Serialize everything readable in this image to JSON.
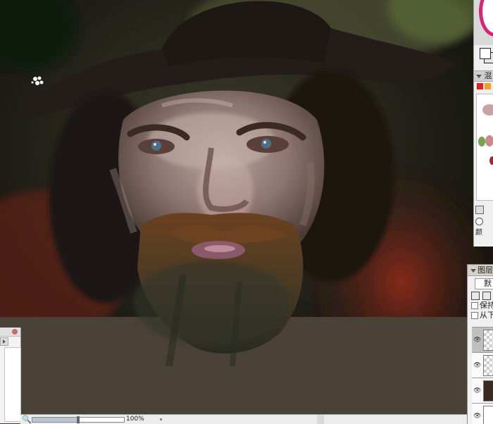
{
  "mixer": {
    "title": "混",
    "colors": [
      "#e02020",
      "#f2a020"
    ]
  },
  "color_panel": {
    "label": "颜"
  },
  "layers": {
    "title": "图层",
    "blend_mode": "默",
    "preserve_label": "保持",
    "from_below_label": "从下"
  },
  "status": {
    "zoom_icon": "🔍",
    "zoom_label": "100%",
    "zoom_level": 0.5
  },
  "icons": [
    "brush-cursor-icon",
    "zoom-icon",
    "eye-icon",
    "new-layer-icon",
    "lock-icon",
    "chevron-down-icon",
    "play-icon"
  ]
}
